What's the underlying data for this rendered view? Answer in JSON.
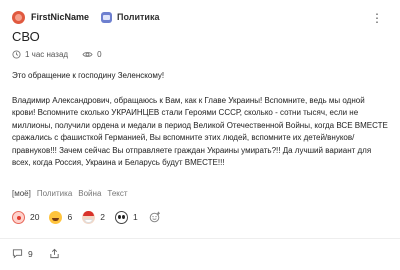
{
  "post": {
    "author": "FirstNicName",
    "community": "Политика",
    "title": "СВО",
    "time": "1 час назад",
    "views": "0",
    "paragraphs": [
      "Это обращение к господину Зеленскому!",
      "Владимир Александрович, обращаюсь к Вам, как к Главе Украины! Вспомните, ведь мы одной крови! Вспомните сколько УКРАИНЦЕВ стали Героями СССР, сколько - сотни тысяч, если не миллионы, получили ордена и медали в период Великой Отечественной Войны, когда ВСЕ ВМЕСТЕ сражались с фашисткой Германией, Вы вспомните этих людей, вспомните их детей/внуков/правнуков!!! Зачем сейчас Вы отправляете граждан Украины умирать?!! Да лучший вариант для всех, когда Россия, Украина и Беларусь будут ВМЕСТЕ!!!"
    ],
    "tags": [
      "[моё]",
      "Политика",
      "Война",
      "Текст"
    ]
  },
  "reactions": [
    {
      "icon": "clown-emoji-icon",
      "count": "20"
    },
    {
      "icon": "laughing-emoji-icon",
      "count": "6"
    },
    {
      "icon": "santa-emoji-icon",
      "count": "2"
    },
    {
      "icon": "panda-emoji-icon",
      "count": "1"
    }
  ],
  "footer": {
    "comments": "9"
  },
  "icons": {
    "menu": "more-vertical-icon",
    "clock": "clock-icon",
    "views": "eye-icon",
    "comments": "comment-icon",
    "share": "share-icon",
    "add_reaction": "add-reaction-icon"
  }
}
